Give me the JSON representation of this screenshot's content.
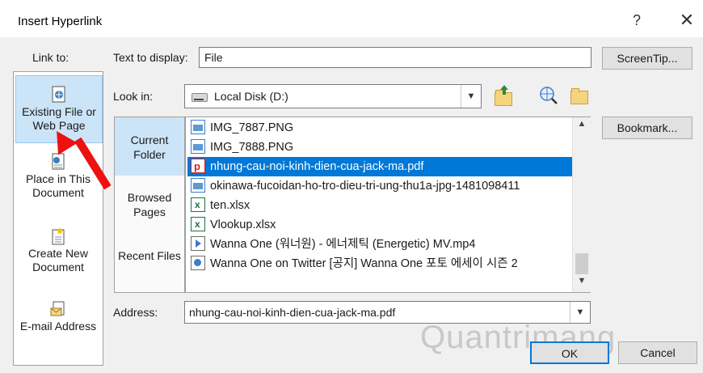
{
  "dialog": {
    "title": "Insert Hyperlink",
    "help_label": "?",
    "close_label": "✕"
  },
  "linkto": {
    "label": "Link to:",
    "items": [
      {
        "label": "Existing File or Web Page",
        "icon": "existing-file-icon",
        "selected": true
      },
      {
        "label": "Place in This Document",
        "icon": "place-in-document-icon",
        "selected": false
      },
      {
        "label": "Create New Document",
        "icon": "create-document-icon",
        "selected": false
      },
      {
        "label": "E-mail Address",
        "icon": "email-address-icon",
        "selected": false
      }
    ]
  },
  "text_to_display": {
    "label": "Text to display:",
    "value": "File"
  },
  "screentip_label": "ScreenTip...",
  "look_in": {
    "label": "Look in:",
    "value": "Local Disk (D:)",
    "icon": "drive-icon"
  },
  "bookmark_label": "Bookmark...",
  "places": [
    {
      "label": "Current Folder",
      "selected": true
    },
    {
      "label": "Browsed Pages",
      "selected": false
    },
    {
      "label": "Recent Files",
      "selected": false
    }
  ],
  "files": [
    {
      "name": "IMG_7887.PNG",
      "type": "img",
      "selected": false
    },
    {
      "name": "IMG_7888.PNG",
      "type": "img",
      "selected": false
    },
    {
      "name": "nhung-cau-noi-kinh-dien-cua-jack-ma.pdf",
      "type": "pdf",
      "selected": true
    },
    {
      "name": "okinawa-fucoidan-ho-tro-dieu-tri-ung-thu1a-jpg-1481098411",
      "type": "img",
      "selected": false
    },
    {
      "name": "ten.xlsx",
      "type": "xls",
      "selected": false
    },
    {
      "name": "Vlookup.xlsx",
      "type": "xls",
      "selected": false
    },
    {
      "name": "Wanna One (워너원) - 에너제틱 (Energetic) MV.mp4",
      "type": "mp4",
      "selected": false
    },
    {
      "name": "Wanna One on Twitter  [공지] Wanna One 포토 에세이 시즌 2",
      "type": "url",
      "selected": false
    }
  ],
  "address": {
    "label": "Address:",
    "value": "nhung-cau-noi-kinh-dien-cua-jack-ma.pdf"
  },
  "ok_label": "OK",
  "cancel_label": "Cancel",
  "watermark": "Quantrimang",
  "colors": {
    "selection": "#0078d7",
    "nav_selected": "#cce4f7",
    "annotation_arrow": "#ee1111"
  }
}
